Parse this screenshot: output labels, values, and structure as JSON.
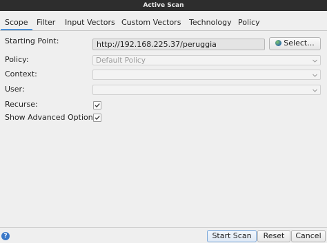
{
  "window": {
    "title": "Active Scan"
  },
  "tabs": [
    "Scope",
    "Filter",
    "Input Vectors",
    "Custom Vectors",
    "Technology",
    "Policy"
  ],
  "form": {
    "starting_point_label": "Starting Point:",
    "starting_point_value": "http://192.168.225.37/peruggia",
    "select_button": "Select...",
    "policy_label": "Policy:",
    "policy_value": "Default Policy",
    "context_label": "Context:",
    "user_label": "User:",
    "recurse_label": "Recurse:",
    "recurse_checked": true,
    "advanced_label": "Show Advanced Options",
    "advanced_checked": true
  },
  "footer": {
    "start_scan": "Start Scan",
    "reset": "Reset",
    "cancel": "Cancel"
  },
  "colors": {
    "titlebar": "#2d2d2d",
    "tab_accent": "#4a90d9",
    "help_icon": "#3a78c8"
  }
}
